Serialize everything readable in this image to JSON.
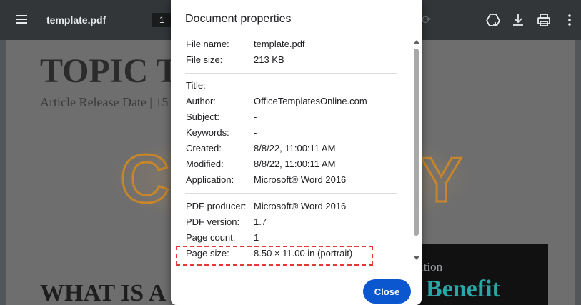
{
  "toolbar": {
    "file_name": "template.pdf",
    "page_number": "1"
  },
  "page_content": {
    "topic_heading": "TOPIC T",
    "release_date": "Article Release Date | 15",
    "what_is_heading": "WHAT IS A",
    "ition_text": "ition",
    "benefit_text": "Benefit"
  },
  "dialog": {
    "title": "Document properties",
    "groups": {
      "file": [
        {
          "key": "File name:",
          "value": "template.pdf"
        },
        {
          "key": "File size:",
          "value": "213 KB"
        }
      ],
      "meta": [
        {
          "key": "Title:",
          "value": "-"
        },
        {
          "key": "Author:",
          "value": "OfficeTemplatesOnline.com"
        },
        {
          "key": "Subject:",
          "value": "-"
        },
        {
          "key": "Keywords:",
          "value": "-"
        },
        {
          "key": "Created:",
          "value": "8/8/22, 11:00:11 AM"
        },
        {
          "key": "Modified:",
          "value": "8/8/22, 11:00:11 AM"
        },
        {
          "key": "Application:",
          "value": "Microsoft® Word 2016"
        }
      ],
      "pdf": [
        {
          "key": "PDF producer:",
          "value": "Microsoft® Word 2016"
        },
        {
          "key": "PDF version:",
          "value": "1.7"
        },
        {
          "key": "Page count:",
          "value": "1"
        },
        {
          "key": "Page size:",
          "value": "8.50 × 11.00 in (portrait)"
        }
      ]
    },
    "close_label": "Close"
  },
  "icons": [
    "menu-icon",
    "rotate-icon",
    "save-to-drive-icon",
    "download-icon",
    "print-icon",
    "more-vert-icon"
  ],
  "colors": {
    "toolbar_bg": "#323639",
    "button_blue": "#0b57d0",
    "highlight_red": "#e53935"
  }
}
